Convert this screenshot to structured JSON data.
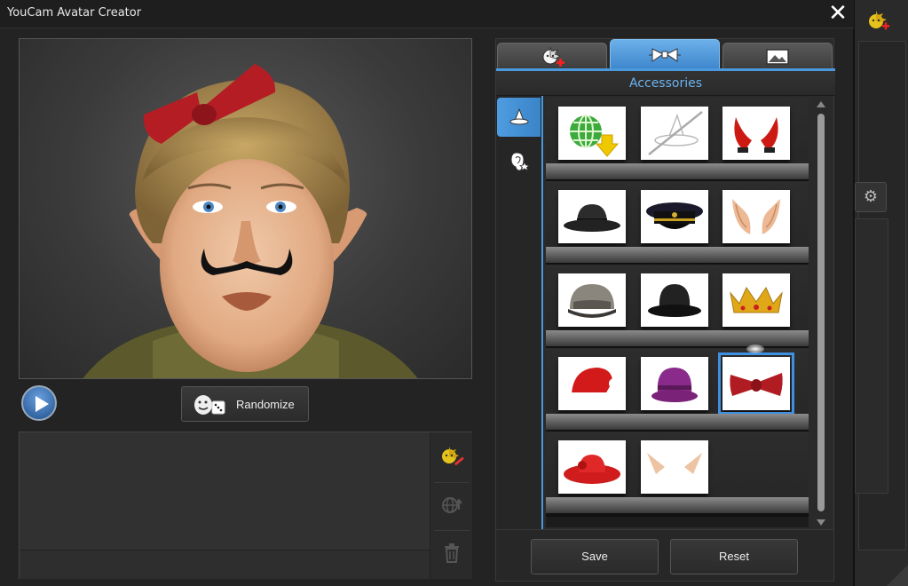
{
  "window": {
    "title": "YouCam Avatar Creator"
  },
  "preview": {
    "play_icon": "play-icon"
  },
  "randomize": {
    "label": "Randomize"
  },
  "tabs": [
    {
      "name": "tab-face",
      "icon": "avatar-add-icon"
    },
    {
      "name": "tab-accessories",
      "icon": "bow-tie-icon",
      "active": true
    },
    {
      "name": "tab-background",
      "icon": "landscape-icon"
    }
  ],
  "section": {
    "title": "Accessories"
  },
  "categories": [
    {
      "name": "hats",
      "icon": "witch-hat-icon",
      "active": true
    },
    {
      "name": "ears",
      "icon": "ear-star-icon"
    }
  ],
  "items": [
    [
      "download-more-icon",
      "no-accessory-icon",
      "devil-horns-icon"
    ],
    [
      "fedora-hat-icon",
      "police-cap-icon",
      "elf-ears-icon"
    ],
    [
      "baseball-cap-icon",
      "bowler-hat-icon",
      "gold-crown-icon"
    ],
    [
      "santa-hat-icon",
      "purple-cloche-icon",
      "red-bow-icon"
    ],
    [
      "red-wide-hat-icon",
      "pointy-elf-ears-icon"
    ]
  ],
  "selected_item": "red-bow-icon",
  "buttons": {
    "save": "Save",
    "reset": "Reset"
  }
}
